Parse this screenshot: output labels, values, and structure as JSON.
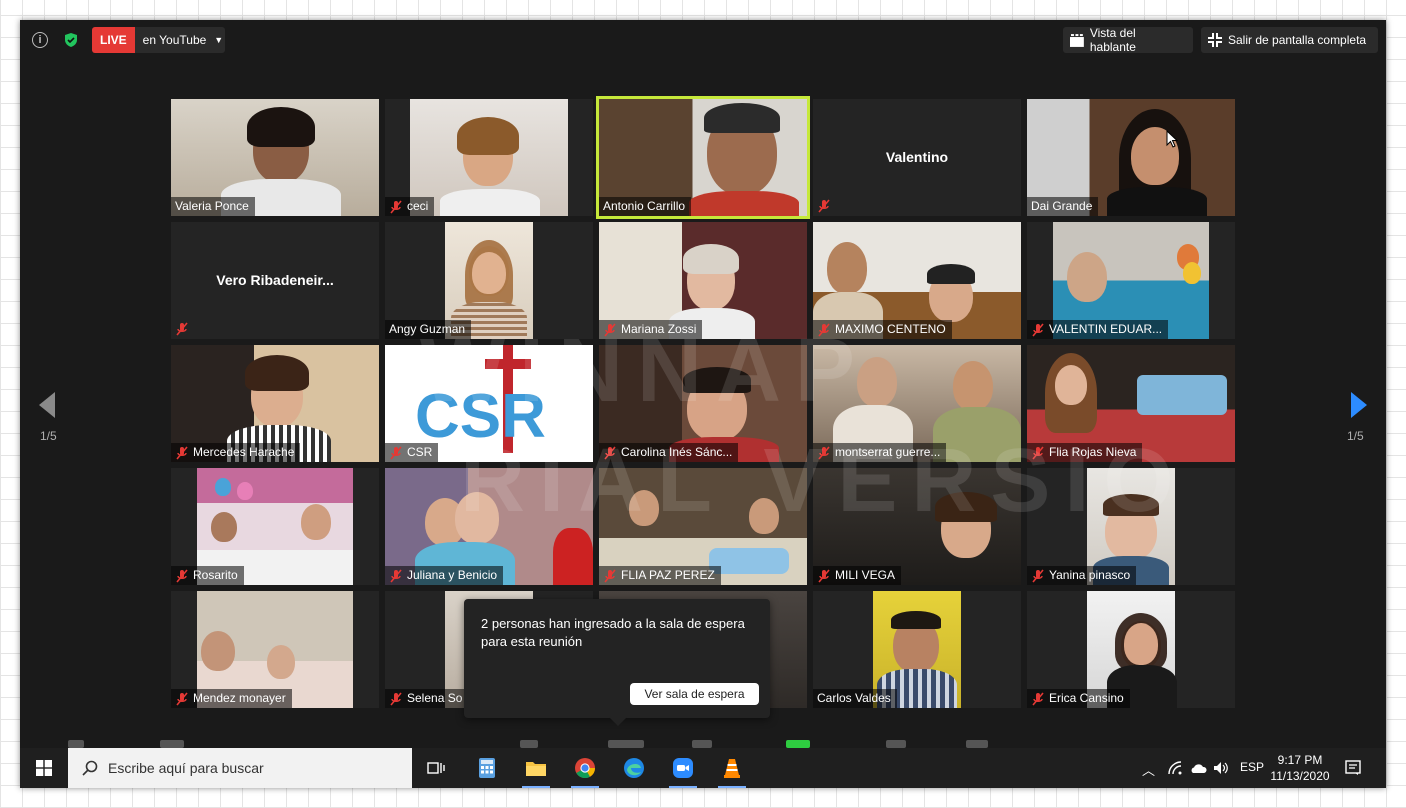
{
  "topbar": {
    "live_label": "LIVE",
    "live_target": "en YouTube",
    "speaker_view_label": "Vista del hablante",
    "exit_fullscreen_label": "Salir de pantalla completa"
  },
  "participants": [
    {
      "name": "Valeria Ponce",
      "muted": false
    },
    {
      "name": "ceci",
      "muted": true
    },
    {
      "name": "Antonio Carrillo",
      "muted": false,
      "active": true
    },
    {
      "name": "Valentino",
      "muted": true,
      "video_off": true
    },
    {
      "name": "Dai Grande",
      "muted": false
    },
    {
      "name": "Vero  Ribadeneir...",
      "muted": true,
      "video_off": true
    },
    {
      "name": "Angy Guzman",
      "muted": false
    },
    {
      "name": "Mariana Zossi",
      "muted": true
    },
    {
      "name": "MAXIMO CENTENO",
      "muted": true
    },
    {
      "name": "VALENTIN EDUAR...",
      "muted": true
    },
    {
      "name": "Mercedes Harache",
      "muted": true
    },
    {
      "name": "CSR",
      "muted": true
    },
    {
      "name": "Carolina Inés Sánc...",
      "muted": true
    },
    {
      "name": "montserrat guerre...",
      "muted": true
    },
    {
      "name": "Flia Rojas Nieva",
      "muted": true
    },
    {
      "name": "Rosarito",
      "muted": true
    },
    {
      "name": "Juliana y Benicio",
      "muted": true
    },
    {
      "name": "FLIA PAZ PEREZ",
      "muted": true
    },
    {
      "name": "MILI VEGA",
      "muted": true
    },
    {
      "name": "Yanina pinasco",
      "muted": true
    },
    {
      "name": "Mendez monayer",
      "muted": true
    },
    {
      "name": "Selena So",
      "muted": true
    },
    {
      "name": "",
      "muted": false
    },
    {
      "name": "Carlos Valdes",
      "muted": false
    },
    {
      "name": "Erica Cansino",
      "muted": true
    }
  ],
  "watermark": [
    "WINNAP",
    "RIAL VERSIO"
  ],
  "paging": {
    "left": "1/5",
    "right": "1/5"
  },
  "popup": {
    "message": "2 personas han ingresado a la sala de espera para esta reunión",
    "button_label": "Ver sala de espera"
  },
  "taskbar": {
    "search_placeholder": "Escribe aquí para buscar",
    "language": "ESP",
    "time": "9:17 PM",
    "date": "11/13/2020"
  },
  "colors": {
    "live": "#e53935",
    "active_speaker": "#c6e83a",
    "next_arrow": "#2d8cff"
  }
}
